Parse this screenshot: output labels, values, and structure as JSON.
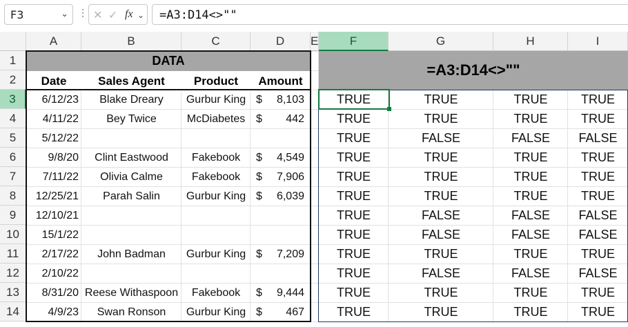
{
  "formula_bar": {
    "name_box": "F3",
    "formula": "=A3:D14<>\"\"",
    "icons": [
      "cancel-icon",
      "enter-check-icon",
      "function-fx-icon",
      "chevron-down-icon"
    ]
  },
  "columns": [
    "A",
    "B",
    "C",
    "D",
    "E",
    "F",
    "G",
    "H",
    "I"
  ],
  "rows": [
    "1",
    "2",
    "3",
    "4",
    "5",
    "6",
    "7",
    "8",
    "9",
    "10",
    "11",
    "12",
    "13",
    "14"
  ],
  "data_table": {
    "title": "DATA",
    "headers": [
      "Date",
      "Sales Agent",
      "Product",
      "Amount"
    ],
    "rows": [
      {
        "date": "6/12/23",
        "agent": "Blake Dreary",
        "product": "Gurbur King",
        "cur": "$",
        "amount": "8,103"
      },
      {
        "date": "4/11/22",
        "agent": "Bey Twice",
        "product": "McDiabetes",
        "cur": "$",
        "amount": "442"
      },
      {
        "date": "5/12/22",
        "agent": "",
        "product": "",
        "cur": "",
        "amount": ""
      },
      {
        "date": "9/8/20",
        "agent": "Clint Eastwood",
        "product": "Fakebook",
        "cur": "$",
        "amount": "4,549"
      },
      {
        "date": "7/11/22",
        "agent": "Olivia Calme",
        "product": "Fakebook",
        "cur": "$",
        "amount": "7,906"
      },
      {
        "date": "12/25/21",
        "agent": "Parah Salin",
        "product": "Gurbur King",
        "cur": "$",
        "amount": "6,039"
      },
      {
        "date": "12/10/21",
        "agent": "",
        "product": "",
        "cur": "",
        "amount": ""
      },
      {
        "date": "15/1/22",
        "agent": "",
        "product": "",
        "cur": "",
        "amount": ""
      },
      {
        "date": "2/17/22",
        "agent": "John Badman",
        "product": "Gurbur King",
        "cur": "$",
        "amount": "7,209"
      },
      {
        "date": "2/10/22",
        "agent": "",
        "product": "",
        "cur": "",
        "amount": ""
      },
      {
        "date": "8/31/20",
        "agent": "Reese Withaspoon",
        "product": "Fakebook",
        "cur": "$",
        "amount": "9,444"
      },
      {
        "date": "4/9/23",
        "agent": "Swan Ronson",
        "product": "Gurbur King",
        "cur": "$",
        "amount": "467"
      }
    ]
  },
  "result_table": {
    "title": "=A3:D14<>\"\"",
    "rows": [
      [
        "TRUE",
        "TRUE",
        "TRUE",
        "TRUE"
      ],
      [
        "TRUE",
        "TRUE",
        "TRUE",
        "TRUE"
      ],
      [
        "TRUE",
        "FALSE",
        "FALSE",
        "FALSE"
      ],
      [
        "TRUE",
        "TRUE",
        "TRUE",
        "TRUE"
      ],
      [
        "TRUE",
        "TRUE",
        "TRUE",
        "TRUE"
      ],
      [
        "TRUE",
        "TRUE",
        "TRUE",
        "TRUE"
      ],
      [
        "TRUE",
        "FALSE",
        "FALSE",
        "FALSE"
      ],
      [
        "TRUE",
        "FALSE",
        "FALSE",
        "FALSE"
      ],
      [
        "TRUE",
        "TRUE",
        "TRUE",
        "TRUE"
      ],
      [
        "TRUE",
        "FALSE",
        "FALSE",
        "FALSE"
      ],
      [
        "TRUE",
        "TRUE",
        "TRUE",
        "TRUE"
      ],
      [
        "TRUE",
        "TRUE",
        "TRUE",
        "TRUE"
      ]
    ]
  },
  "colors": {
    "title_fill": "#a6a6a6",
    "selection": "#107c41",
    "header_selected": "#a9dcbf"
  }
}
